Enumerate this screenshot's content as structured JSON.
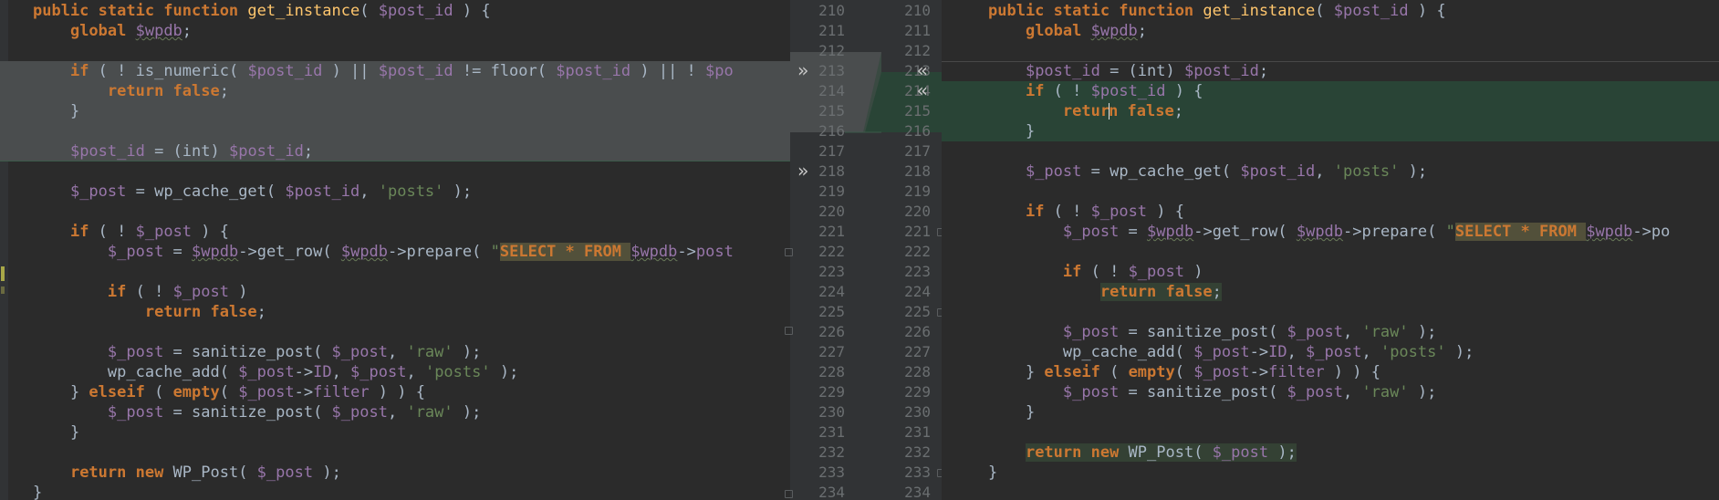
{
  "left_pane": {
    "lines": [
      {
        "state": "normal",
        "tokens": [
          [
            "kw",
            "public static function "
          ],
          [
            "fn",
            "get_instance"
          ],
          [
            "p",
            "( "
          ],
          [
            "var",
            "$post_id"
          ],
          [
            "p",
            " ) {"
          ]
        ]
      },
      {
        "state": "normal",
        "tokens": [
          [
            "p",
            "    "
          ],
          [
            "kw",
            "global "
          ],
          [
            "varw",
            "$wpdb"
          ],
          [
            "p",
            ";"
          ]
        ]
      },
      {
        "state": "normal",
        "tokens": []
      },
      {
        "state": "removed",
        "tokens": [
          [
            "p",
            "    "
          ],
          [
            "kw",
            "if "
          ],
          [
            "p",
            "( ! is_numeric( "
          ],
          [
            "var",
            "$post_id"
          ],
          [
            "p",
            " ) || "
          ],
          [
            "var",
            "$post_id"
          ],
          [
            "p",
            " != floor( "
          ],
          [
            "var",
            "$post_id"
          ],
          [
            "p",
            " ) || ! "
          ],
          [
            "var",
            "$po"
          ]
        ]
      },
      {
        "state": "removed",
        "tokens": [
          [
            "p",
            "        "
          ],
          [
            "kw",
            "return false"
          ],
          [
            "p",
            ";"
          ]
        ]
      },
      {
        "state": "removed",
        "tokens": [
          [
            "p",
            "    }"
          ]
        ]
      },
      {
        "state": "removed",
        "tokens": []
      },
      {
        "state": "removed-last",
        "tokens": [
          [
            "p",
            "    "
          ],
          [
            "var",
            "$post_id"
          ],
          [
            "p",
            " = (int) "
          ],
          [
            "var",
            "$post_id"
          ],
          [
            "p",
            ";"
          ]
        ]
      },
      {
        "state": "normal",
        "tokens": []
      },
      {
        "state": "normal",
        "tokens": [
          [
            "p",
            "    "
          ],
          [
            "var",
            "$_post"
          ],
          [
            "p",
            " = wp_cache_get( "
          ],
          [
            "var",
            "$post_id"
          ],
          [
            "p",
            ", "
          ],
          [
            "str",
            "'posts'"
          ],
          [
            "p",
            " );"
          ]
        ]
      },
      {
        "state": "normal",
        "tokens": []
      },
      {
        "state": "normal",
        "tokens": [
          [
            "p",
            "    "
          ],
          [
            "kw",
            "if "
          ],
          [
            "p",
            "( ! "
          ],
          [
            "var",
            "$_post"
          ],
          [
            "p",
            " ) {"
          ]
        ]
      },
      {
        "state": "normal",
        "tokens": [
          [
            "p",
            "        "
          ],
          [
            "var",
            "$_post"
          ],
          [
            "p",
            " = "
          ],
          [
            "varw",
            "$wpdb"
          ],
          [
            "p",
            "->"
          ],
          [
            "fnp",
            "get_row"
          ],
          [
            "p",
            "( "
          ],
          [
            "varw",
            "$wpdb"
          ],
          [
            "p",
            "->"
          ],
          [
            "fnp",
            "prepare"
          ],
          [
            "p",
            "( "
          ],
          [
            "str",
            "\""
          ],
          [
            "sql",
            "SELECT * FROM "
          ],
          [
            "varw",
            "$wpdb"
          ],
          [
            "p",
            "->"
          ],
          [
            "var",
            "post"
          ]
        ]
      },
      {
        "state": "normal",
        "tokens": []
      },
      {
        "state": "normal",
        "tokens": [
          [
            "p",
            "        "
          ],
          [
            "kw",
            "if "
          ],
          [
            "p",
            "( ! "
          ],
          [
            "var",
            "$_post"
          ],
          [
            "p",
            " )"
          ]
        ]
      },
      {
        "state": "normal",
        "tokens": [
          [
            "p",
            "            "
          ],
          [
            "kw",
            "return false"
          ],
          [
            "p",
            ";"
          ]
        ]
      },
      {
        "state": "normal",
        "tokens": []
      },
      {
        "state": "normal",
        "tokens": [
          [
            "p",
            "        "
          ],
          [
            "var",
            "$_post"
          ],
          [
            "p",
            " = sanitize_post( "
          ],
          [
            "var",
            "$_post"
          ],
          [
            "p",
            ", "
          ],
          [
            "str",
            "'raw'"
          ],
          [
            "p",
            " );"
          ]
        ]
      },
      {
        "state": "normal",
        "tokens": [
          [
            "p",
            "        wp_cache_add( "
          ],
          [
            "var",
            "$_post"
          ],
          [
            "p",
            "->"
          ],
          [
            "var",
            "ID"
          ],
          [
            "p",
            ", "
          ],
          [
            "var",
            "$_post"
          ],
          [
            "p",
            ", "
          ],
          [
            "str",
            "'posts'"
          ],
          [
            "p",
            " );"
          ]
        ]
      },
      {
        "state": "normal",
        "tokens": [
          [
            "p",
            "    } "
          ],
          [
            "kw",
            "elseif "
          ],
          [
            "p",
            "( "
          ],
          [
            "kw",
            "empty"
          ],
          [
            "p",
            "( "
          ],
          [
            "var",
            "$_post"
          ],
          [
            "p",
            "->"
          ],
          [
            "var",
            "filter"
          ],
          [
            "p",
            " ) ) {"
          ]
        ]
      },
      {
        "state": "normal",
        "tokens": [
          [
            "p",
            "        "
          ],
          [
            "var",
            "$_post"
          ],
          [
            "p",
            " = sanitize_post( "
          ],
          [
            "var",
            "$_post"
          ],
          [
            "p",
            ", "
          ],
          [
            "str",
            "'raw'"
          ],
          [
            "p",
            " );"
          ]
        ]
      },
      {
        "state": "normal",
        "tokens": [
          [
            "p",
            "    }"
          ]
        ]
      },
      {
        "state": "normal",
        "tokens": []
      },
      {
        "state": "normal",
        "tokens": [
          [
            "p",
            "    "
          ],
          [
            "kw",
            "return new "
          ],
          [
            "p",
            "WP_Post( "
          ],
          [
            "var",
            "$_post"
          ],
          [
            "p",
            " );"
          ]
        ]
      },
      {
        "state": "normal",
        "tokens": [
          [
            "p",
            "}"
          ]
        ]
      }
    ]
  },
  "right_pane": {
    "lines": [
      {
        "state": "normal",
        "tokens": [
          [
            "kw",
            "public static function "
          ],
          [
            "fn",
            "get_instance"
          ],
          [
            "p",
            "( "
          ],
          [
            "var",
            "$post_id"
          ],
          [
            "p",
            " ) {"
          ]
        ]
      },
      {
        "state": "normal",
        "tokens": [
          [
            "p",
            "    "
          ],
          [
            "kw",
            "global "
          ],
          [
            "varw",
            "$wpdb"
          ],
          [
            "p",
            ";"
          ]
        ]
      },
      {
        "state": "normal",
        "tokens": []
      },
      {
        "state": "sep",
        "tokens": [
          [
            "p",
            "    "
          ],
          [
            "var",
            "$post_id"
          ],
          [
            "p",
            " = (int) "
          ],
          [
            "var",
            "$post_id"
          ],
          [
            "p",
            ";"
          ]
        ]
      },
      {
        "state": "changed",
        "tokens": [
          [
            "p",
            "    "
          ],
          [
            "kw",
            "if "
          ],
          [
            "p",
            "( ! "
          ],
          [
            "var",
            "$post_id"
          ],
          [
            "p",
            " ) {"
          ]
        ]
      },
      {
        "state": "changed",
        "tokens": [
          [
            "p",
            "        "
          ],
          [
            "kw",
            "retur"
          ],
          [
            "caret",
            ""
          ],
          [
            "kw",
            "n false"
          ],
          [
            "p",
            ";"
          ]
        ]
      },
      {
        "state": "changed",
        "tokens": [
          [
            "p",
            "    }"
          ]
        ]
      },
      {
        "state": "normal",
        "tokens": []
      },
      {
        "state": "normal",
        "tokens": [
          [
            "p",
            "    "
          ],
          [
            "var",
            "$_post"
          ],
          [
            "p",
            " = wp_cache_get( "
          ],
          [
            "var",
            "$post_id"
          ],
          [
            "p",
            ", "
          ],
          [
            "str",
            "'posts'"
          ],
          [
            "p",
            " );"
          ]
        ]
      },
      {
        "state": "normal",
        "tokens": []
      },
      {
        "state": "normal",
        "tokens": [
          [
            "p",
            "    "
          ],
          [
            "kw",
            "if "
          ],
          [
            "p",
            "( ! "
          ],
          [
            "var",
            "$_post"
          ],
          [
            "p",
            " ) {"
          ]
        ]
      },
      {
        "state": "normal",
        "tokens": [
          [
            "p",
            "        "
          ],
          [
            "var",
            "$_post"
          ],
          [
            "p",
            " = "
          ],
          [
            "varw",
            "$wpdb"
          ],
          [
            "p",
            "->"
          ],
          [
            "fnp",
            "get_row"
          ],
          [
            "p",
            "( "
          ],
          [
            "varw",
            "$wpdb"
          ],
          [
            "p",
            "->"
          ],
          [
            "fnp",
            "prepare"
          ],
          [
            "p",
            "( "
          ],
          [
            "str",
            "\""
          ],
          [
            "sql",
            "SELECT * FROM "
          ],
          [
            "varw",
            "$wpdb"
          ],
          [
            "p",
            "->po"
          ]
        ]
      },
      {
        "state": "normal",
        "tokens": []
      },
      {
        "state": "normal",
        "tokens": [
          [
            "p",
            "        "
          ],
          [
            "kw",
            "if "
          ],
          [
            "p",
            "( ! "
          ],
          [
            "var",
            "$_post"
          ],
          [
            "p",
            " )"
          ]
        ]
      },
      {
        "state": "normal",
        "tokens": [
          [
            "p",
            "            "
          ],
          [
            "kwhl",
            "return false"
          ],
          [
            "phl",
            ";"
          ]
        ]
      },
      {
        "state": "normal",
        "tokens": []
      },
      {
        "state": "normal",
        "tokens": [
          [
            "p",
            "        "
          ],
          [
            "var",
            "$_post"
          ],
          [
            "p",
            " = sanitize_post( "
          ],
          [
            "var",
            "$_post"
          ],
          [
            "p",
            ", "
          ],
          [
            "str",
            "'raw'"
          ],
          [
            "p",
            " );"
          ]
        ]
      },
      {
        "state": "normal",
        "tokens": [
          [
            "p",
            "        wp_cache_add( "
          ],
          [
            "var",
            "$_post"
          ],
          [
            "p",
            "->"
          ],
          [
            "var",
            "ID"
          ],
          [
            "p",
            ", "
          ],
          [
            "var",
            "$_post"
          ],
          [
            "p",
            ", "
          ],
          [
            "str",
            "'posts'"
          ],
          [
            "p",
            " );"
          ]
        ]
      },
      {
        "state": "normal",
        "tokens": [
          [
            "p",
            "    } "
          ],
          [
            "kw",
            "elseif "
          ],
          [
            "p",
            "( "
          ],
          [
            "kw",
            "empty"
          ],
          [
            "p",
            "( "
          ],
          [
            "var",
            "$_post"
          ],
          [
            "p",
            "->"
          ],
          [
            "var",
            "filter"
          ],
          [
            "p",
            " ) ) {"
          ]
        ]
      },
      {
        "state": "normal",
        "tokens": [
          [
            "p",
            "        "
          ],
          [
            "var",
            "$_post"
          ],
          [
            "p",
            " = sanitize_post( "
          ],
          [
            "var",
            "$_post"
          ],
          [
            "p",
            ", "
          ],
          [
            "str",
            "'raw'"
          ],
          [
            "p",
            " );"
          ]
        ]
      },
      {
        "state": "normal",
        "tokens": [
          [
            "p",
            "    }"
          ]
        ]
      },
      {
        "state": "normal",
        "tokens": []
      },
      {
        "state": "normal",
        "tokens": [
          [
            "p",
            "    "
          ],
          [
            "kwhl",
            "return new "
          ],
          [
            "phl",
            "WP_Post( "
          ],
          [
            "varhl",
            "$_post"
          ],
          [
            "phl",
            " );"
          ]
        ]
      },
      {
        "state": "normal",
        "tokens": [
          [
            "p",
            "}"
          ]
        ]
      },
      {
        "state": "normal",
        "tokens": []
      }
    ]
  },
  "gutter": {
    "left_numbers": [
      "210",
      "211",
      "212",
      "213",
      "214",
      "215",
      "216",
      "217",
      "218",
      "219",
      "220",
      "221",
      "222",
      "223",
      "224",
      "225",
      "226",
      "227",
      "228",
      "229",
      "230",
      "231",
      "232",
      "233",
      "234"
    ],
    "right_numbers": [
      "210",
      "211",
      "212",
      "213",
      "214",
      "215",
      "216",
      "217",
      "218",
      "219",
      "220",
      "221",
      "222",
      "223",
      "224",
      "225",
      "226",
      "227",
      "228",
      "229",
      "230",
      "231",
      "232",
      "233",
      "234"
    ],
    "apply_left_arrow": "»",
    "revert_arrow": "«"
  },
  "colors": {
    "background": "#2b2b2b",
    "removed_block": "#4a4d4e",
    "changed_block": "#294436",
    "keyword": "#cc7832",
    "variable": "#9876aa",
    "function": "#ffc66d",
    "string": "#6a8759"
  }
}
